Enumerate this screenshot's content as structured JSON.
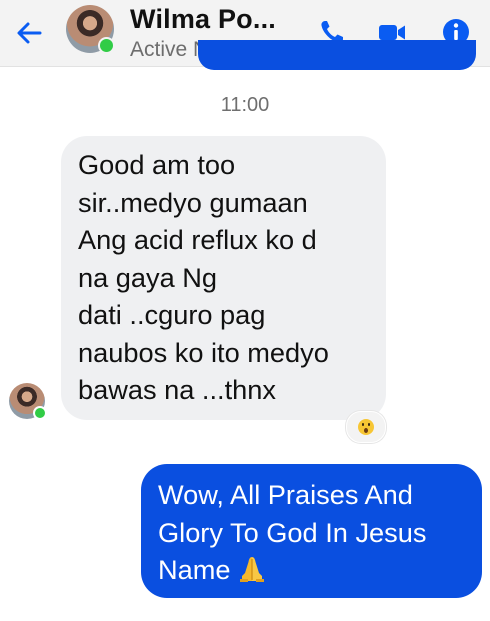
{
  "header": {
    "contact_name": "Wilma Po...",
    "status": "Active Now",
    "icons": [
      "back-arrow-icon",
      "phone-icon",
      "video-camera-icon",
      "info-icon"
    ],
    "accent_color": "#0a4fe0",
    "online_color": "#31cc46"
  },
  "conversation": {
    "timestamp": "11:00",
    "incoming": {
      "text": "Good am too\nsir..medyo gumaan\nAng acid reflux ko d\nna gaya Ng\ndati ..cguro pag\nnaubos ko ito medyo\nbawas na ...thnx",
      "reaction": "surprised-face-emoji"
    },
    "outgoing": {
      "text": "Wow, All Praises And Glory To God In Jesus Name",
      "emoji": "folded-hands-emoji"
    }
  }
}
